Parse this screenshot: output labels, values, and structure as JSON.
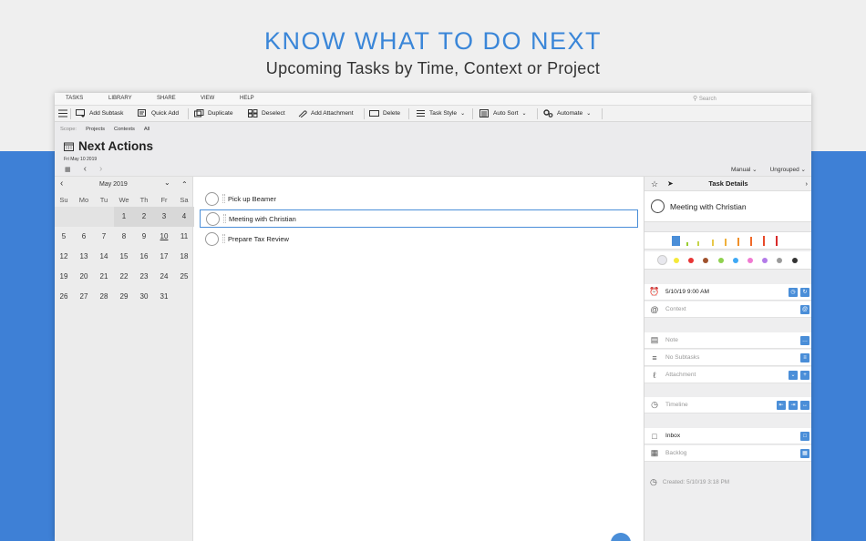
{
  "hero": {
    "headline": "KNOW WHAT TO DO NEXT",
    "subheadline": "Upcoming Tasks by Time, Context or Project"
  },
  "menubar": {
    "items": [
      "TASKS",
      "LIBRARY",
      "SHARE",
      "VIEW",
      "HELP"
    ],
    "search_placeholder": "Search"
  },
  "toolbar": {
    "add_subtask": "Add Subtask",
    "quick_add": "Quick Add",
    "duplicate": "Duplicate",
    "deselect": "Deselect",
    "add_attachment": "Add Attachment",
    "delete": "Delete",
    "task_style": "Task Style",
    "auto_sort": "Auto Sort",
    "automate": "Automate"
  },
  "header": {
    "scope_label": "Scope:",
    "scope_options": [
      "Projects",
      "Contexts",
      "All"
    ],
    "title": "Next Actions",
    "date": "Fri May 10 2019",
    "sort_mode": "Manual",
    "grouping": "Ungrouped"
  },
  "calendar": {
    "month_label": "May 2019",
    "weekdays": [
      "Su",
      "Mo",
      "Tu",
      "We",
      "Th",
      "Fr",
      "Sa"
    ],
    "weeks": [
      [
        "",
        "",
        "",
        "1",
        "2",
        "3",
        "4"
      ],
      [
        "5",
        "6",
        "7",
        "8",
        "9",
        "10",
        "11"
      ],
      [
        "12",
        "13",
        "14",
        "15",
        "16",
        "17",
        "18"
      ],
      [
        "19",
        "20",
        "21",
        "22",
        "23",
        "24",
        "25"
      ],
      [
        "26",
        "27",
        "28",
        "29",
        "30",
        "31",
        ""
      ]
    ],
    "today": "10"
  },
  "tasks": [
    {
      "title": "Pick up Beamer",
      "selected": false
    },
    {
      "title": "Meeting with Christian",
      "selected": true
    },
    {
      "title": "Prepare Tax Review",
      "selected": false
    }
  ],
  "details": {
    "header": "Task Details",
    "task_title": "Meeting with Christian",
    "colors": [
      "#e8e8ee",
      "#f5e93a",
      "#e83535",
      "#a0522d",
      "#8fd14f",
      "#3fa9f5",
      "#f07ad1",
      "#b37be8",
      "#9a9a9a",
      "#333333"
    ],
    "due": "5/10/19 9:00 AM",
    "context_placeholder": "Context",
    "note_placeholder": "Note",
    "subtasks": "No Subtasks",
    "attachment": "Attachment",
    "timeline": "Timeline",
    "project": "Inbox",
    "backlog": "Backlog",
    "created": "Created: 5/10/19 3:18 PM"
  }
}
